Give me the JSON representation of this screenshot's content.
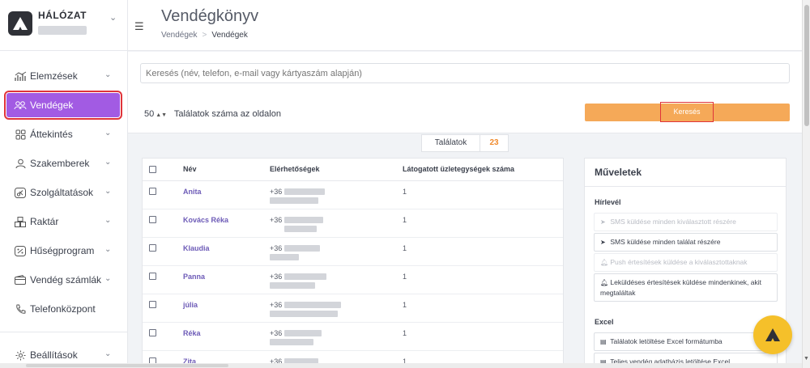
{
  "brand": {
    "title": "HÁLÓZAT"
  },
  "header": {
    "title": "Vendégkönyv",
    "breadcrumb": {
      "parent": "Vendégek",
      "separator": ">",
      "current": "Vendégek"
    }
  },
  "sidebar": {
    "items": [
      {
        "label": "Elemzések",
        "icon": "chart-icon",
        "chevron": true
      },
      {
        "label": "Vendégek",
        "icon": "users-icon",
        "chevron": false,
        "active": true
      },
      {
        "label": "Áttekintés",
        "icon": "grid-icon",
        "chevron": true
      },
      {
        "label": "Szakemberek",
        "icon": "person-icon",
        "chevron": true
      },
      {
        "label": "Szolgáltatások",
        "icon": "scissors-icon",
        "chevron": true
      },
      {
        "label": "Raktár",
        "icon": "boxes-icon",
        "chevron": true
      },
      {
        "label": "Hűségprogram",
        "icon": "percent-icon",
        "chevron": true
      },
      {
        "label": "Vendég számlák",
        "icon": "wallet-icon",
        "chevron": true
      },
      {
        "label": "Telefonközpont",
        "icon": "phone-icon",
        "chevron": false
      }
    ],
    "bottom": {
      "label": "Beállítások",
      "icon": "settings-icon"
    }
  },
  "search": {
    "placeholder": "Keresés (név, telefon, e-mail vagy kártyaszám alapján)",
    "per_page_value": "50",
    "per_page_label": "Találatok száma az oldalon",
    "button_label": "Keresés"
  },
  "results": {
    "label": "Találatok",
    "count": "23"
  },
  "table": {
    "headers": {
      "name": "Név",
      "contact": "Elérhetőségek",
      "visited": "Látogatott üzletegységek száma"
    },
    "rows": [
      {
        "name": "Anita",
        "phone_prefix": "+36",
        "visited": "1"
      },
      {
        "name": "Kovács Réka",
        "phone_prefix": "+36",
        "visited": "1"
      },
      {
        "name": "Klaudia",
        "phone_prefix": "+36",
        "visited": "1"
      },
      {
        "name": "Panna",
        "phone_prefix": "+36",
        "visited": "1"
      },
      {
        "name": "júlia",
        "phone_prefix": "+36",
        "visited": "1"
      },
      {
        "name": "Réka",
        "phone_prefix": "+36",
        "visited": "1"
      },
      {
        "name": "Zita",
        "phone_prefix": "+36",
        "visited": "1"
      }
    ]
  },
  "actions": {
    "title": "Műveletek",
    "newsletter_title": "Hírlevél",
    "sms_selected": "SMS küldése minden kiválasztott részére",
    "sms_all": "SMS küldése minden találat részére",
    "push_selected": "Push értesítések küldése a kiválasztottaknak",
    "push_all": "Leküldéses értesítések küldése mindenkinek, akit megtaláltak",
    "excel_title": "Excel",
    "excel_results": "Találatok letöltése Excel formátumba",
    "excel_full": "Teljes vendég adatbázis letöltése Excel formátumban"
  },
  "colors": {
    "accent": "#a25be3",
    "search_button": "#f5a958",
    "highlight": "#e0343a",
    "fab": "#f5c02a",
    "count": "#f08a2c"
  }
}
